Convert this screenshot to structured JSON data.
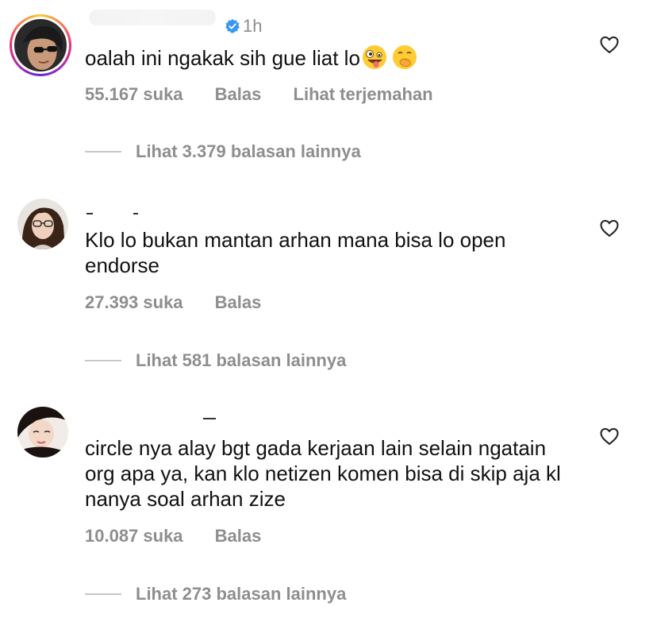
{
  "comments": [
    {
      "time": "1h",
      "text": "oalah ini ngakak sih gue liat lo",
      "emojis": [
        "zany-face-emoji",
        "face-with-hand-over-mouth-emoji"
      ],
      "likes": "55.167 suka",
      "reply_label": "Balas",
      "translate_label": "Lihat terjemahan",
      "more_replies": "Lihat 3.379 balasan lainnya"
    },
    {
      "text": "Klo lo bukan mantan arhan mana bisa lo open endorse",
      "likes": "27.393 suka",
      "reply_label": "Balas",
      "more_replies": "Lihat 581 balasan lainnya"
    },
    {
      "text": "circle nya alay bgt gada kerjaan lain selain ngatain org apa ya, kan klo netizen komen bisa di skip aja kl nanya soal arhan zize",
      "likes": "10.087 suka",
      "reply_label": "Balas",
      "more_replies": "Lihat 273 balasan lainnya"
    }
  ],
  "colors": {
    "text": "#111111",
    "meta": "#8e8e8e",
    "verified": "#3897f0",
    "heart_outline": "#262626"
  }
}
